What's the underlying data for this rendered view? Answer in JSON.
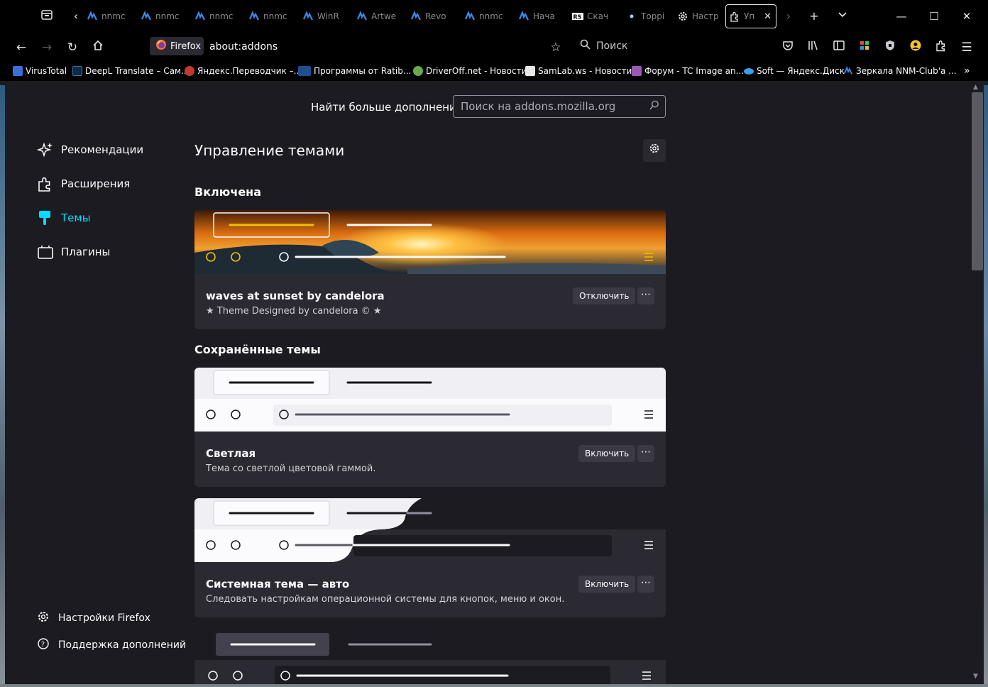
{
  "tabs": [
    {
      "label": "nnmc",
      "icon": "nnm-icon"
    },
    {
      "label": "nnmc",
      "icon": "nnm-icon"
    },
    {
      "label": "nnmc",
      "icon": "nnm-icon"
    },
    {
      "label": "nnmc",
      "icon": "nnm-icon"
    },
    {
      "label": "WinR",
      "icon": "nnm-icon"
    },
    {
      "label": "Artwe",
      "icon": "nnm-icon"
    },
    {
      "label": "Revo",
      "icon": "nnm-icon"
    },
    {
      "label": "nnmc",
      "icon": "nnm-icon"
    },
    {
      "label": "Нача",
      "icon": "nnm-icon"
    },
    {
      "label": "Скач",
      "icon": "rs-icon"
    },
    {
      "label": "Торрі",
      "icon": "dot-icon"
    },
    {
      "label": "Настр",
      "icon": "gear-icon"
    }
  ],
  "active_tab": {
    "label": "Уп"
  },
  "identity": {
    "label": "Firefox"
  },
  "url": "about:addons",
  "nav_search": {
    "label": "Поиск"
  },
  "bookmarks": [
    {
      "label": "VirusTotal",
      "color": "#3a6fd8"
    },
    {
      "label": "DeepL Translate – Сам...",
      "color": "#0f2b46"
    },
    {
      "label": "Яндекс.Переводчик –...",
      "color": "#c0392b"
    },
    {
      "label": "Программы от Ratib...",
      "color": "#1d4f91"
    },
    {
      "label": "DriverOff.net - Новости",
      "color": "#6aa84f"
    },
    {
      "label": "SamLab.ws - Новости",
      "color": "#e8e8e8"
    },
    {
      "label": "Форум - TC Image an...",
      "color": "#9b59b6"
    },
    {
      "label": "Soft — Яндекс.Диск",
      "color": "#3aa0e8"
    },
    {
      "label": "Зеркала NNM-Club'а ...",
      "color": "#3a8ae8"
    }
  ],
  "find_more": "Найти больше дополнений",
  "amo_search": {
    "placeholder": "Поиск на addons.mozilla.org"
  },
  "sidebar": {
    "categories": [
      {
        "label": "Рекомендации"
      },
      {
        "label": "Расширения"
      },
      {
        "label": "Темы"
      },
      {
        "label": "Плагины"
      }
    ],
    "settings_label": "Настройки Firefox",
    "support_label": "Поддержка дополнений"
  },
  "page_title": "Управление темами",
  "enabled_heading": "Включена",
  "saved_heading": "Сохранённые темы",
  "themes": {
    "enabled": {
      "name": "waves at sunset by candelora",
      "desc": "★ Theme Designed by candelora © ★",
      "button": "Отключить"
    },
    "saved": [
      {
        "name": "Светлая",
        "desc": "Тема со светлой цветовой гаммой.",
        "button": "Включить"
      },
      {
        "name": "Системная тема — авто",
        "desc": "Следовать настройкам операционной системы для кнопок, меню и окон.",
        "button": "Включить"
      }
    ]
  },
  "colors": {
    "accent": "#00ddff",
    "background": "#1c1b22",
    "card": "#2b2a33"
  }
}
